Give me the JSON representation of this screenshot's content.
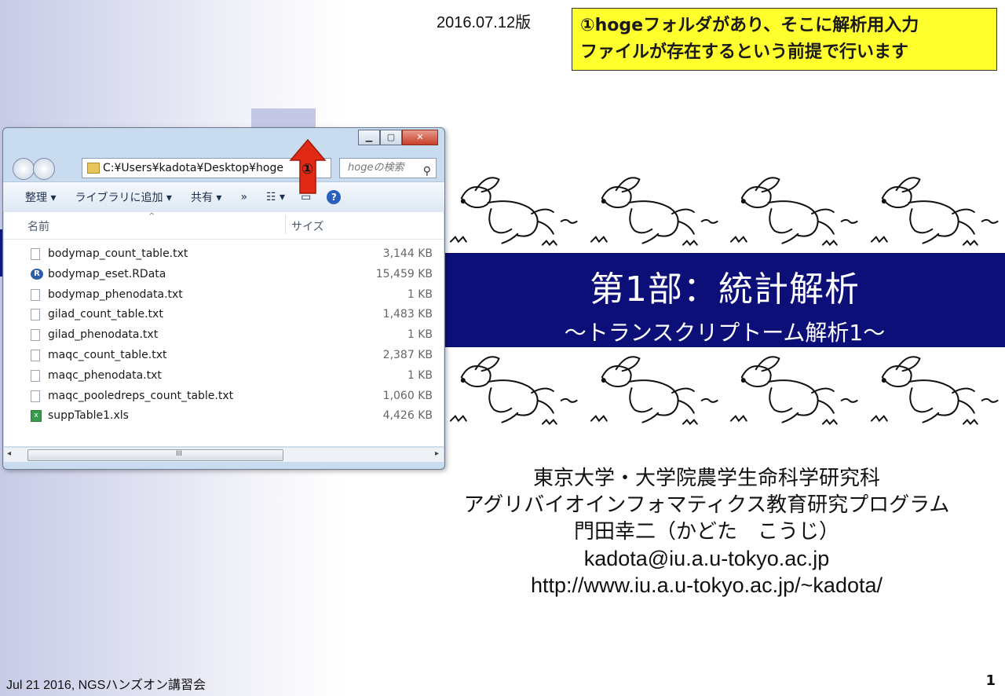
{
  "slide": {
    "version": "2016.07.12版",
    "callout_lines": [
      "①hogeフォルダがあり、そこに解析用入力",
      "ファイルが存在するという前提で行います"
    ],
    "title": "第1部：統計解析",
    "subtitle": "～トランスクリプトーム解析1～",
    "author_lines": [
      "東京大学・大学院農学生命科学研究科",
      "アグリバイオインフォマティクス教育研究プログラム",
      "門田幸二（かどた　こうじ）",
      "kadota@iu.a.u-tokyo.ac.jp",
      "http://www.iu.a.u-tokyo.ac.jp/~kadota/"
    ],
    "footer": "Jul 21 2016, NGSハンズオン講習会",
    "page_number": "1",
    "callout_marker": "①"
  },
  "explorer": {
    "address": "C:¥Users¥kadota¥Desktop¥hoge",
    "search_placeholder": "hogeの検索",
    "toolbar": {
      "organize": "整理 ▾",
      "add_to_library": "ライブラリに追加 ▾",
      "share": "共有 ▾",
      "more": "»"
    },
    "columns": {
      "name": "名前",
      "size": "サイズ"
    },
    "files": [
      {
        "name": "bodymap_count_table.txt",
        "size": "3,144 KB",
        "type": "txt"
      },
      {
        "name": "bodymap_eset.RData",
        "size": "15,459 KB",
        "type": "r"
      },
      {
        "name": "bodymap_phenodata.txt",
        "size": "1 KB",
        "type": "txt"
      },
      {
        "name": "gilad_count_table.txt",
        "size": "1,483 KB",
        "type": "txt"
      },
      {
        "name": "gilad_phenodata.txt",
        "size": "1 KB",
        "type": "txt"
      },
      {
        "name": "maqc_count_table.txt",
        "size": "2,387 KB",
        "type": "txt"
      },
      {
        "name": "maqc_phenodata.txt",
        "size": "1 KB",
        "type": "txt"
      },
      {
        "name": "maqc_pooledreps_count_table.txt",
        "size": "1,060 KB",
        "type": "txt"
      },
      {
        "name": "suppTable1.xls",
        "size": "4,426 KB",
        "type": "xls"
      }
    ]
  },
  "colors": {
    "banner": "#0d0f78",
    "callout_bg": "#ffff2e",
    "arrow": "#e02a16"
  }
}
